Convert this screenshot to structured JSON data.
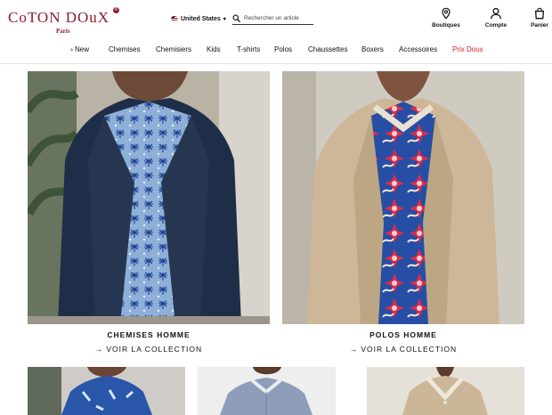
{
  "header": {
    "logo": {
      "brand": "CoTON DOuX",
      "city": "Paris",
      "registered": "®"
    },
    "country": "United States",
    "search": {
      "placeholder": "Rechercher un article"
    },
    "actions": [
      {
        "label": "Boutiques",
        "icon": "location-pin-icon"
      },
      {
        "label": "Compte",
        "icon": "user-icon"
      },
      {
        "label": "Panier",
        "icon": "shopping-bag-icon"
      }
    ]
  },
  "nav": {
    "items": [
      {
        "label": "New",
        "icon": "sparkle-icon"
      },
      {
        "label": "Chemises"
      },
      {
        "label": "Chemisiers"
      },
      {
        "label": "Kids"
      },
      {
        "label": "T-shirts"
      },
      {
        "label": "Polos"
      },
      {
        "label": "Chaussettes"
      },
      {
        "label": "Boxers"
      },
      {
        "label": "Accessoires"
      },
      {
        "label": "Prix Doux"
      }
    ]
  },
  "features": [
    {
      "title": "CHEMISES HOMME",
      "link": "VOIR LA COLLECTION",
      "link_icon": "arrow-right-icon"
    },
    {
      "title": "POLOS HOMME",
      "link": "VOIR LA COLLECTION",
      "link_icon": "arrow-right-icon"
    }
  ],
  "colors": {
    "brand": "#8b1d2c",
    "promo": "#d41d2a",
    "text": "#111111"
  }
}
